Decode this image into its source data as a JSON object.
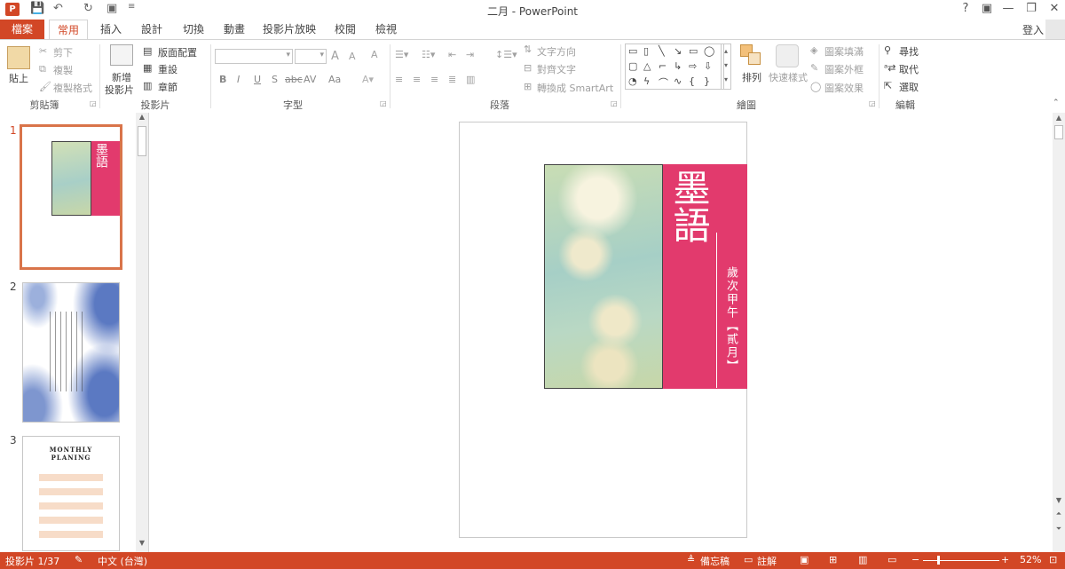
{
  "titlebar": {
    "title": "二月 - PowerPoint",
    "app_icon": "P",
    "qa_save": "💾",
    "qa_undo": "↶",
    "qa_redo": "↻",
    "qa_present": "▣",
    "qa_more": "≡",
    "help": "?",
    "ribbon_display": "▣",
    "minimize": "—",
    "restore": "❐",
    "close": "✕"
  },
  "tabs": {
    "file": "檔案",
    "home": "常用",
    "insert": "插入",
    "design": "設計",
    "transitions": "切換",
    "animations": "動畫",
    "slideshow": "投影片放映",
    "review": "校閱",
    "view": "檢視",
    "login": "登入"
  },
  "ribbon": {
    "clipboard": {
      "paste": "貼上",
      "cut": "剪下",
      "copy": "複製",
      "format_painter": "複製格式",
      "label": "剪貼簿"
    },
    "slides": {
      "new_slide_1": "新增",
      "new_slide_2": "投影片",
      "layout": "版面配置",
      "reset": "重設",
      "section": "章節",
      "label": "投影片"
    },
    "font": {
      "bold": "B",
      "italic": "I",
      "underline": "U",
      "shadow": "S",
      "strike": "abc",
      "spacing": "AV",
      "case": "Aa",
      "grow": "A",
      "shrink": "A",
      "clear": "A",
      "label": "字型"
    },
    "paragraph": {
      "text_direction": "文字方向",
      "align_text": "對齊文字",
      "smartart": "轉換成 SmartArt",
      "label": "段落"
    },
    "drawing": {
      "arrange": "排列",
      "quick_styles": "快速樣式",
      "shape_fill": "圖案填滿",
      "shape_outline": "圖案外框",
      "shape_effects": "圖案效果",
      "label": "繪圖"
    },
    "editing": {
      "find": "尋找",
      "replace": "取代",
      "select": "選取",
      "label": "編輯"
    }
  },
  "thumbnails": {
    "slide1_num": "1",
    "slide2_num": "2",
    "slide3_num": "3",
    "slide3_title_1": "MONTHLY",
    "slide3_title_2": "PLANING"
  },
  "slide": {
    "main_title": "墨語",
    "subtitle": "歲次甲午【貳月】"
  },
  "statusbar": {
    "slide_count": "投影片 1/37",
    "language": "中文 (台灣)",
    "notes": "備忘稿",
    "comments": "註解",
    "zoom": "52%"
  },
  "colors": {
    "accent": "#d24726",
    "slide_band": "#e23a6d"
  }
}
